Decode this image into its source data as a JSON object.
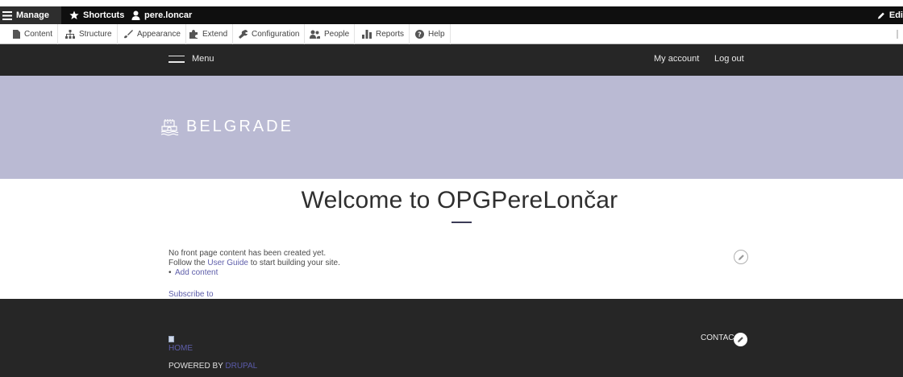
{
  "admin_toolbar": {
    "manage": "Manage",
    "shortcuts": "Shortcuts",
    "user": "pere.loncar",
    "edit": "Edi"
  },
  "admin_tray": {
    "items": [
      {
        "label": "Content",
        "icon": "file-icon"
      },
      {
        "label": "Structure",
        "icon": "sitemap-icon"
      },
      {
        "label": "Appearance",
        "icon": "brush-icon"
      },
      {
        "label": "Extend",
        "icon": "puzzle-icon"
      },
      {
        "label": "Configuration",
        "icon": "wrench-icon"
      },
      {
        "label": "People",
        "icon": "people-icon"
      },
      {
        "label": "Reports",
        "icon": "bar-chart-icon"
      },
      {
        "label": "Help",
        "icon": "help-icon"
      }
    ]
  },
  "nav": {
    "menu_label": "Menu",
    "my_account": "My account",
    "log_out": "Log out"
  },
  "site": {
    "name": "BELGRADE"
  },
  "main": {
    "title": "Welcome to OPGPereLončar",
    "no_content": "No front page content has been created yet.",
    "follow_prefix": "Follow the ",
    "user_guide": "User Guide",
    "follow_suffix": " to start building your site.",
    "add_content": "Add content",
    "subscribe": "Subscribe to"
  },
  "footer": {
    "home": "HOME",
    "powered_prefix": "POWERED BY ",
    "powered_link": "DRUPAL",
    "contact": "CONTAC"
  },
  "colors": {
    "toolbar": "#0f0f0f",
    "nav": "#262626",
    "hero": "#babad3",
    "link": "#5e5eaa"
  }
}
